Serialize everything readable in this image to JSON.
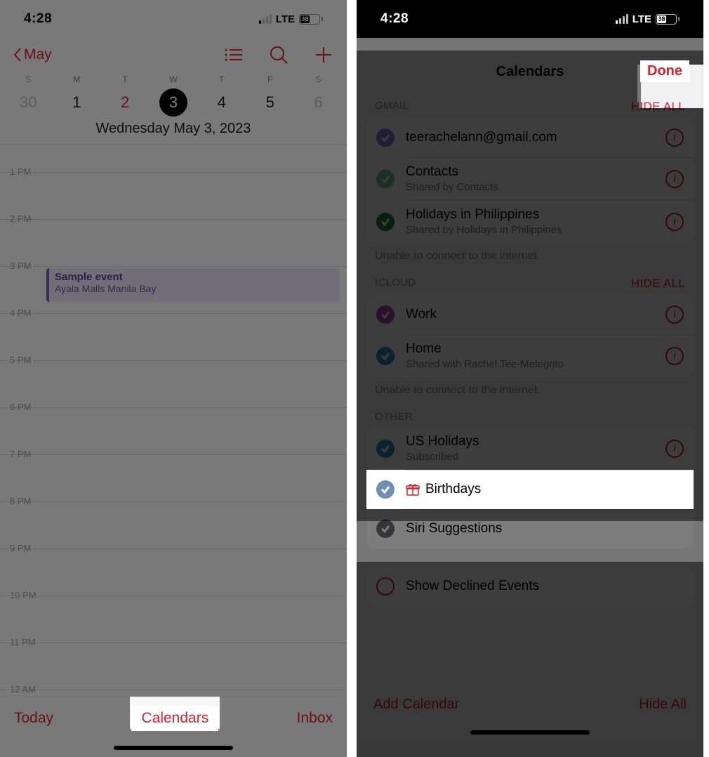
{
  "left": {
    "status": {
      "time": "4:28",
      "carrier": "LTE",
      "battery": "38"
    },
    "nav": {
      "back": "May"
    },
    "week": {
      "days": [
        "S",
        "M",
        "T",
        "W",
        "T",
        "F",
        "S"
      ]
    },
    "dates": [
      "30",
      "1",
      "2",
      "3",
      "4",
      "5",
      "6"
    ],
    "fulldate": "Wednesday  May 3, 2023",
    "hours": [
      "1 PM",
      "2 PM",
      "3 PM",
      "4 PM",
      "5 PM",
      "6 PM",
      "7 PM",
      "8 PM",
      "9 PM",
      "10 PM",
      "11 PM",
      "12 AM"
    ],
    "event": {
      "title": "Sample event",
      "location": "Ayala Malls Manila Bay"
    },
    "bottom": {
      "today": "Today",
      "calendars": "Calendars",
      "inbox": "Inbox"
    }
  },
  "right": {
    "status": {
      "time": "4:28",
      "carrier": "LTE",
      "battery": "38"
    },
    "title": "Calendars",
    "done": "Done",
    "sections": {
      "gmail": {
        "header": "GMAIL",
        "hide": "HIDE ALL",
        "items": [
          {
            "name": "teerachelann@gmail.com",
            "sub": "",
            "color": "#8a7ad8"
          },
          {
            "name": "Contacts",
            "sub": "Shared by Contacts",
            "color": "#6fc9a4"
          },
          {
            "name": "Holidays in Philippines",
            "sub": "Shared by Holidays in Philippines",
            "color": "#1e8a3b"
          }
        ],
        "note": "Unable to connect to the internet."
      },
      "icloud": {
        "header": "ICLOUD",
        "hide": "HIDE ALL",
        "items": [
          {
            "name": "Work",
            "sub": "",
            "color": "#b24bb5"
          },
          {
            "name": "Home",
            "sub": "Shared with Rachel Tee-Melegrito",
            "color": "#2b8fbd"
          }
        ],
        "note": "Unable to connect to the internet."
      },
      "other": {
        "header": "OTHER",
        "items": [
          {
            "name": "US Holidays",
            "sub": "Subscribed",
            "color": "#2b8fbd",
            "info": true
          },
          {
            "name": "Birthdays",
            "sub": "",
            "color": "#6f8fb3",
            "gift": true
          },
          {
            "name": "Siri Suggestions",
            "sub": "",
            "color": "#6d6d72"
          }
        ]
      },
      "declined": {
        "label": "Show Declined Events"
      }
    },
    "bottom": {
      "add": "Add Calendar",
      "hideall": "Hide All"
    }
  }
}
